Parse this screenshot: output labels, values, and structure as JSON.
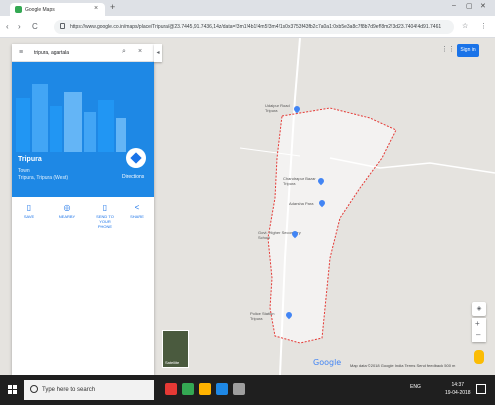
{
  "browser": {
    "tab_title": "Google Maps",
    "new_tab_glyph": "+",
    "close_glyph": "×",
    "url": "https://www.google.co.in/maps/place/Tripura/@23.7445,91.7436,14z/data=!3m1!4b1!4m5!3m4!1s0x3753f43fb2c7a0a1:0xb5e3a8c7f8b7d9ef!8m2!3d23.7404!4d91.7461",
    "back_glyph": "‹",
    "forward_glyph": "›",
    "reload_glyph": "C",
    "star_glyph": "☆",
    "menu_glyph": "⋮",
    "min_glyph": "–",
    "max_glyph": "▢",
    "win_close_glyph": "✕"
  },
  "panel": {
    "search_value": "tripura, agartala",
    "menu_glyph": "≡",
    "search_glyph": "⌕",
    "clear_glyph": "×",
    "collapse_glyph": "◂",
    "place_title": "Tripura",
    "place_type": "Town",
    "place_sub": "Tripura, Tripura (West)",
    "directions_label": "Directions",
    "actions": [
      {
        "icon": "▯",
        "label": "SAVE"
      },
      {
        "icon": "◎",
        "label": "NEARBY"
      },
      {
        "icon": "▯",
        "label": "SEND TO YOUR PHONE"
      },
      {
        "icon": "<",
        "label": "SHARE"
      }
    ],
    "hero_color": "#1e88e5"
  },
  "map": {
    "pois": [
      {
        "name": "Udaipur Road",
        "sub": "Tripura"
      },
      {
        "name": "Chandrapur Bazar",
        "sub": "Tripura"
      },
      {
        "name": "Adarsha Para",
        "sub": ""
      },
      {
        "name": "Govt. Higher Secondary",
        "sub": "School"
      },
      {
        "name": "Police Station",
        "sub": "Tripura"
      }
    ],
    "apps_glyph": "⋮⋮",
    "sign_in": "Sign in",
    "satellite_label": "Satellite",
    "google_logo": "Google",
    "footer": "Map data ©2018 Google   India   Terms   Send feedback   500 m",
    "zoom_in": "+",
    "zoom_out": "–",
    "compass_glyph": "◈",
    "boundary_color": "#e53935"
  },
  "taskbar": {
    "search_placeholder": "Type here to search",
    "tray_text": "ENG",
    "time": "14:37",
    "date": "19-04-2018",
    "apps": [
      "#e53935",
      "#34a853",
      "#ffb300",
      "#1e88e5",
      "#9e9e9e"
    ]
  }
}
